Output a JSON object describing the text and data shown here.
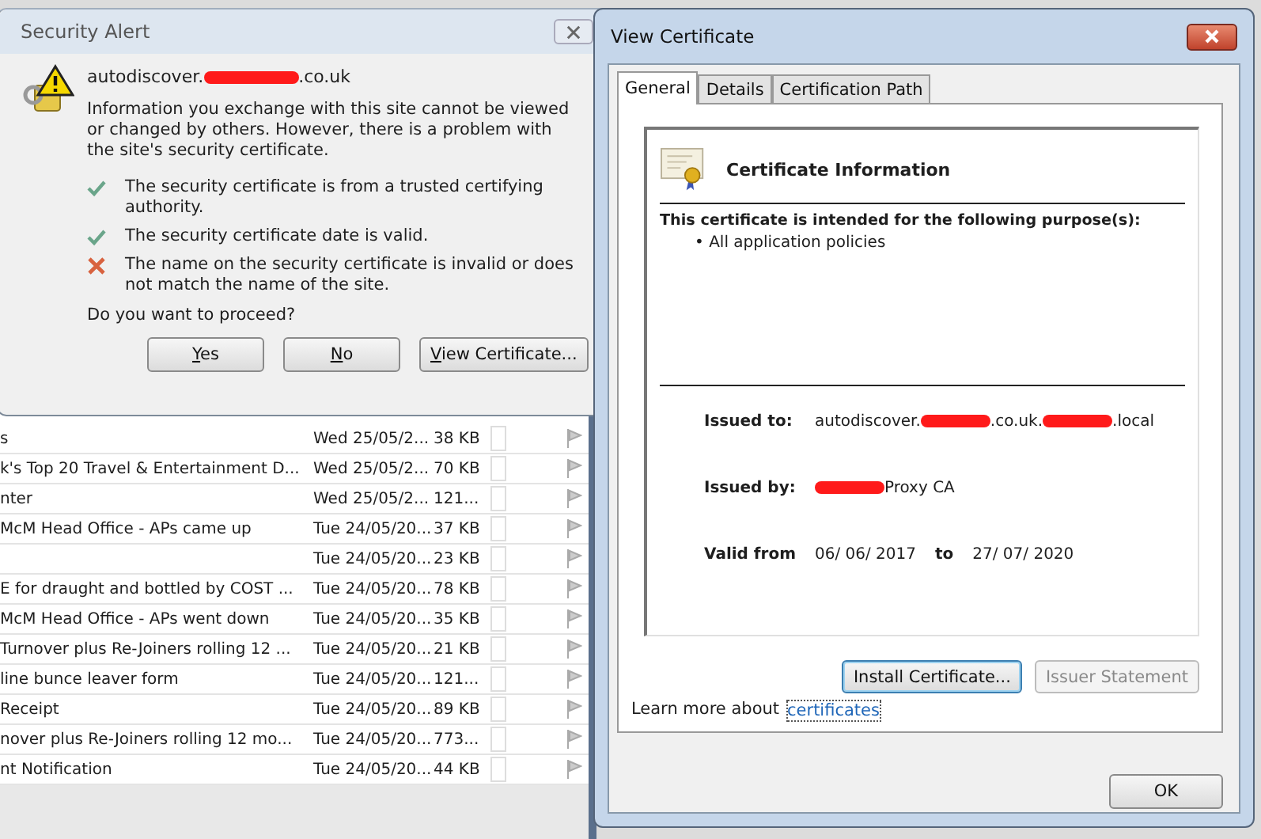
{
  "mail_list": {
    "rows": [
      {
        "subject": "s",
        "date": "Wed 25/05/2...",
        "size": "38 KB"
      },
      {
        "subject": "k's Top 20 Travel & Entertainment D...",
        "date": "Wed 25/05/2...",
        "size": "70 KB"
      },
      {
        "subject": "nter",
        "date": "Wed 25/05/2...",
        "size": "121..."
      },
      {
        "subject": "McM Head Office - APs came up",
        "date": "Tue 24/05/20...",
        "size": "37 KB"
      },
      {
        "subject": "",
        "date": "Tue 24/05/20...",
        "size": "23 KB"
      },
      {
        "subject": "E for draught and bottled by COST ...",
        "date": "Tue 24/05/20...",
        "size": "78 KB"
      },
      {
        "subject": "McM Head Office - APs went down",
        "date": "Tue 24/05/20...",
        "size": "35 KB"
      },
      {
        "subject": "Turnover plus Re-Joiners rolling 12 ...",
        "date": "Tue 24/05/20...",
        "size": "21 KB"
      },
      {
        "subject": "line bunce leaver form",
        "date": "Tue 24/05/20...",
        "size": "121..."
      },
      {
        "subject": "Receipt",
        "date": "Tue 24/05/20...",
        "size": "89 KB"
      },
      {
        "subject": "nover plus Re-Joiners rolling 12 mo...",
        "date": "Tue 24/05/20...",
        "size": "773..."
      },
      {
        "subject": "nt Notification",
        "date": "Tue 24/05/20...",
        "size": "44 KB"
      }
    ]
  },
  "security_alert": {
    "title": "Security Alert",
    "host": [
      {
        "kind": "text",
        "text": "autodiscover."
      },
      {
        "kind": "redacted"
      },
      {
        "kind": "text",
        "text": ".co.uk"
      }
    ],
    "message": "Information you exchange with this site cannot be viewed or changed by others. However, there is a problem with the site's security certificate.",
    "checks": [
      {
        "kind": "ok",
        "text": "The security certificate is from a trusted certifying authority."
      },
      {
        "kind": "ok",
        "text": "The security certificate date is valid."
      },
      {
        "kind": "error",
        "text": "The name on the security certificate is invalid or does not match the name of the site."
      }
    ],
    "question": "Do you want to proceed?",
    "buttons": [
      {
        "access_key": "Y",
        "label_rest": "es"
      },
      {
        "access_key": "N",
        "label_rest": "o"
      },
      {
        "access_key": "V",
        "label_rest": "iew Certificate..."
      }
    ]
  },
  "view_certificate": {
    "title": "View Certificate",
    "tabs": [
      {
        "label": "General",
        "selected": true
      },
      {
        "label": "Details",
        "selected": false
      },
      {
        "label": "Certification Path",
        "selected": false
      }
    ],
    "info_title": "Certificate Information",
    "purpose_heading": "This certificate is intended for the following purpose(s):",
    "purposes": [
      "• All application policies"
    ],
    "fields": [
      {
        "label": "Issued to:",
        "parts": [
          {
            "kind": "text",
            "text": "autodiscover."
          },
          {
            "kind": "redacted"
          },
          {
            "kind": "text",
            "text": ".co.uk."
          },
          {
            "kind": "redacted"
          },
          {
            "kind": "text",
            "text": ".local"
          }
        ]
      },
      {
        "label": "Issued by:",
        "parts": [
          {
            "kind": "redacted"
          },
          {
            "kind": "text",
            "text": "Proxy CA"
          }
        ]
      }
    ],
    "valid": {
      "from_label": "Valid from",
      "from": "06/ 06/ 2017",
      "to_label": "to",
      "to": "27/ 07/ 2020"
    },
    "buttons": [
      {
        "label": "Install Certificate...",
        "disabled": false
      },
      {
        "label": "Issuer Statement",
        "disabled": true
      }
    ],
    "learn_more": {
      "text": "Learn more about",
      "link": "certificates"
    },
    "ok": "OK"
  }
}
